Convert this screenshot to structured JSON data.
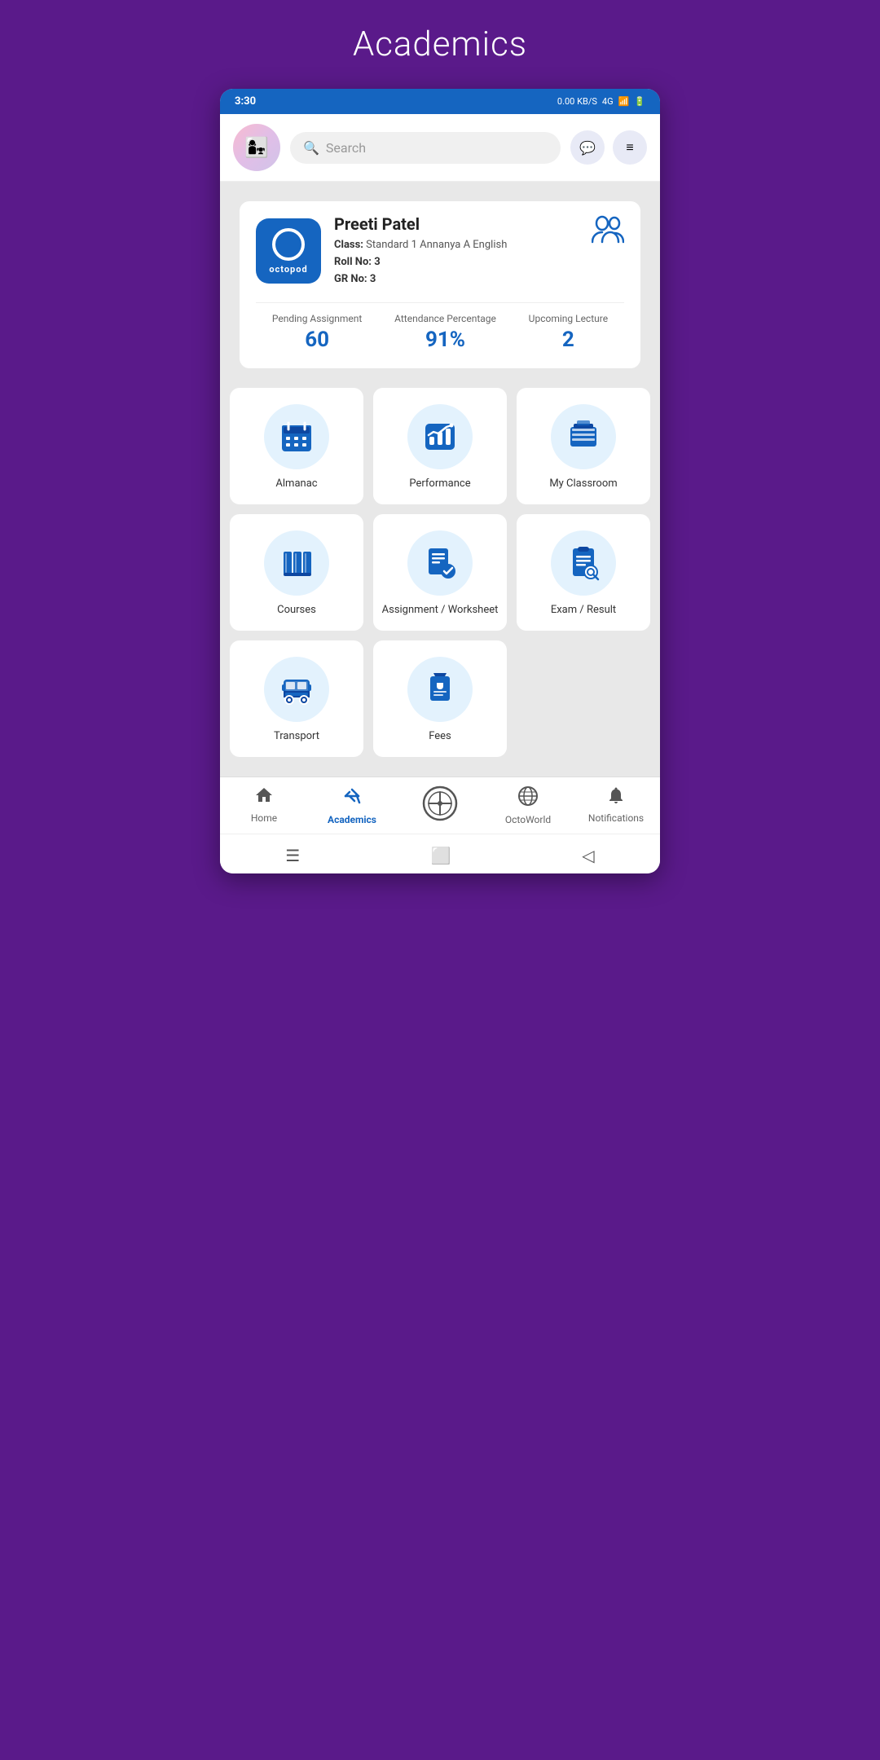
{
  "page": {
    "title": "Academics",
    "bg_color": "#5a1a8a"
  },
  "status_bar": {
    "time": "3:30",
    "network_speed": "0.00 KB/S",
    "network_type": "4G",
    "battery": "6"
  },
  "header": {
    "search_placeholder": "Search",
    "chat_icon": "💬",
    "menu_icon": "☰"
  },
  "profile": {
    "name": "Preeti Patel",
    "class_label": "Class:",
    "class_value": "Standard 1 Annanya A English",
    "roll_label": "Roll No:",
    "roll_value": "3",
    "gr_label": "GR No:",
    "gr_value": "3",
    "logo_text": "octopod",
    "pending_assignment_label": "Pending Assignment",
    "pending_assignment_value": "60",
    "attendance_label": "Attendance Percentage",
    "attendance_value": "91%",
    "upcoming_lecture_label": "Upcoming Lecture",
    "upcoming_lecture_value": "2"
  },
  "grid_items": [
    {
      "id": "almanac",
      "label": "Almanac",
      "icon": "calendar"
    },
    {
      "id": "performance",
      "label": "Performance",
      "icon": "chart"
    },
    {
      "id": "my-classroom",
      "label": "My Classroom",
      "icon": "books-stack"
    },
    {
      "id": "courses",
      "label": "Courses",
      "icon": "books"
    },
    {
      "id": "assignment-worksheet",
      "label": "Assignment / Worksheet",
      "icon": "assignment"
    },
    {
      "id": "exam-result",
      "label": "Exam / Result",
      "icon": "exam"
    },
    {
      "id": "transport",
      "label": "Transport",
      "icon": "bus"
    },
    {
      "id": "fees",
      "label": "Fees",
      "icon": "fees"
    }
  ],
  "bottom_nav": [
    {
      "id": "home",
      "label": "Home",
      "icon": "🏠",
      "active": false
    },
    {
      "id": "academics",
      "label": "Academics",
      "icon": "✏️",
      "active": true
    },
    {
      "id": "octoplus",
      "label": "",
      "icon": "⊕",
      "active": false
    },
    {
      "id": "octoworld",
      "label": "OctoWorld",
      "icon": "🌐",
      "active": false
    },
    {
      "id": "notifications",
      "label": "Notifications",
      "icon": "🔔",
      "active": false
    }
  ],
  "system_nav": {
    "menu": "☰",
    "home": "⬜",
    "back": "◁"
  }
}
